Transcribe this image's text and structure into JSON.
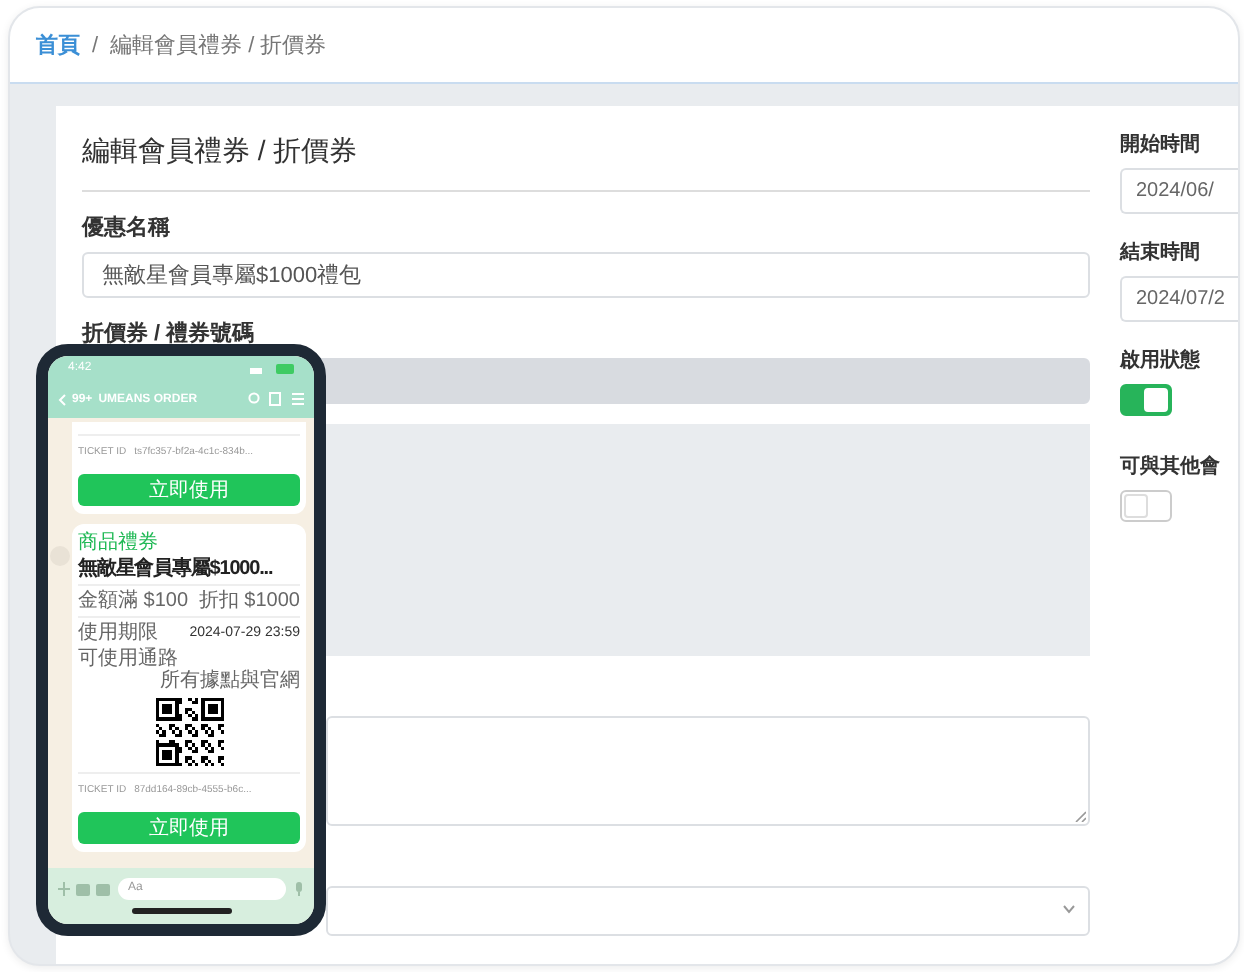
{
  "breadcrumb": {
    "items": [
      {
        "label": "首頁",
        "kind": "link"
      },
      {
        "label": "編輯會員禮券 / 折價券",
        "kind": "current"
      }
    ],
    "separator": "/"
  },
  "form": {
    "title": "編輯會員禮券 / 折價券",
    "fields": [
      {
        "label": "優惠名稱",
        "kind": "input",
        "value": "無敵星會員專屬$1000禮包"
      },
      {
        "label": "折價券 / 禮券號碼",
        "kind": "disabled"
      },
      {
        "kind": "image_area"
      },
      {
        "kind": "textarea"
      },
      {
        "kind": "select"
      }
    ]
  },
  "side": {
    "fields": [
      {
        "label": "開始時間",
        "kind": "date",
        "value": "2024/06/"
      },
      {
        "label": "結束時間",
        "kind": "date",
        "value": "2024/07/2"
      },
      {
        "label": "啟用狀態",
        "kind": "toggle",
        "on": true
      },
      {
        "label": "可與其他會",
        "kind": "toggle",
        "on": false
      }
    ]
  },
  "phone": {
    "status_time": "4:42",
    "header": {
      "back_count": "99+",
      "title": "UMEANS ORDER"
    },
    "messages": [
      {
        "kind": "ticket_tail",
        "ticket_label": "TICKET ID",
        "ticket_id": "ts7fc357-bf2a-4c1c-834b...",
        "button": "立即使用"
      },
      {
        "kind": "coupon",
        "tag": "商品禮券",
        "title": "無敵星會員專屬$1000...",
        "rows": [
          {
            "label": "金額滿 $100",
            "value": "折扣 $1000"
          },
          {
            "label": "使用期限",
            "value": "2024-07-29 23:59"
          },
          {
            "label": "可使用通路",
            "value": "所有據點與官網"
          }
        ],
        "ticket_label": "TICKET ID",
        "ticket_id": "87dd164-89cb-4555-b6c...",
        "button": "立即使用"
      }
    ],
    "input_placeholder": "Aa"
  }
}
